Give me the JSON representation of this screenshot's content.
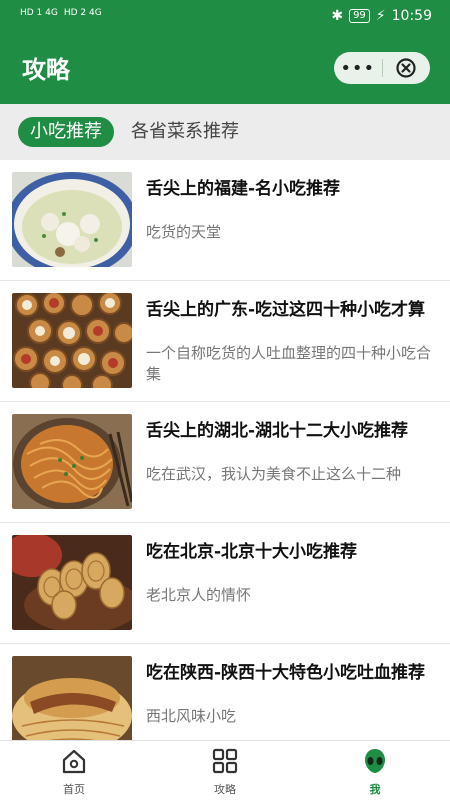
{
  "status_bar": {
    "sim1": "HD 1 4G",
    "sim2": "HD 2 4G",
    "battery": "99",
    "time": "10:59"
  },
  "header": {
    "title": "攻略",
    "more_label": "•••"
  },
  "tabs": [
    {
      "label": "小吃推荐",
      "active": true
    },
    {
      "label": "各省菜系推荐",
      "active": false
    }
  ],
  "articles": [
    {
      "title": "舌尖上的福建-名小吃推荐",
      "desc": "吃货的天堂",
      "thumb": "fujian-dumpling-soup-photo"
    },
    {
      "title": "舌尖上的广东-吃过这四十种小吃才算",
      "desc": "一个自称吃货的人吐血整理的四十种小吃合集",
      "thumb": "guangdong-dim-sum-photo"
    },
    {
      "title": "舌尖上的湖北-湖北十二大小吃推荐",
      "desc": "吃在武汉，我认为美食不止这么十二种",
      "thumb": "hubei-noodles-photo"
    },
    {
      "title": "吃在北京-北京十大小吃推荐",
      "desc": "老北京人的情怀",
      "thumb": "beijing-rolls-photo"
    },
    {
      "title": "吃在陕西-陕西十大特色小吃吐血推荐",
      "desc": "西北风味小吃",
      "thumb": "shaanxi-roujiamo-photo"
    }
  ],
  "bottom_nav": [
    {
      "label": "首页",
      "icon": "home-icon",
      "active": false
    },
    {
      "label": "攻略",
      "icon": "grid-icon",
      "active": false
    },
    {
      "label": "我",
      "icon": "alien-icon",
      "active": true
    }
  ],
  "colors": {
    "brand": "#1f8d43",
    "capsule_bg": "#e8f2ea",
    "tab_bar_bg": "#ececec"
  }
}
